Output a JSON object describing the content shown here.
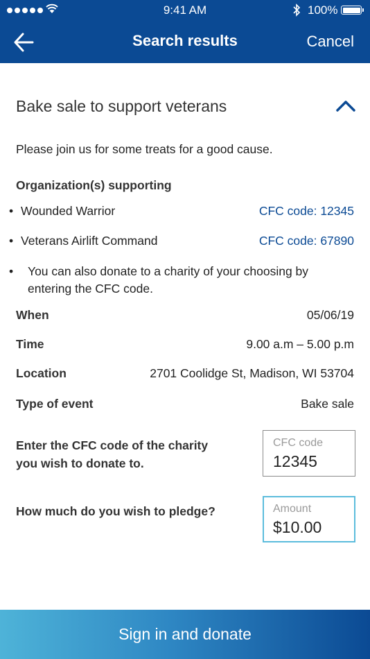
{
  "status_bar": {
    "time": "9:41 AM",
    "battery": "100%"
  },
  "nav": {
    "title": "Search results",
    "cancel_label": "Cancel",
    "back_icon": "arrow-left-icon"
  },
  "event": {
    "title": "Bake sale to support veterans",
    "collapse_icon": "chevron-up-icon",
    "description": "Please join us for some treats for a good cause.",
    "organizations_heading": "Organization(s) supporting",
    "organizations": [
      {
        "name": "Wounded Warrior",
        "cfc": "CFC code: 12345"
      },
      {
        "name": "Veterans Airlift Command",
        "cfc": "CFC code: 67890"
      }
    ],
    "note": "You can also donate to a charity of your choosing by entering the CFC code.",
    "details": [
      {
        "label": "When",
        "value": "05/06/19"
      },
      {
        "label": "Time",
        "value": "9.00 a.m – 5.00 p.m"
      },
      {
        "label": "Location",
        "value": "2701 Coolidge St, Madison, WI 53704"
      },
      {
        "label": "Type of event",
        "value": "Bake sale"
      }
    ]
  },
  "form": {
    "cfc_prompt": "Enter the CFC code of the charity you wish to donate to.",
    "cfc_field_label": "CFC code",
    "cfc_field_value": "12345",
    "amount_prompt": "How much do you wish to pledge?",
    "amount_field_label": "Amount",
    "amount_field_value": "$10.00"
  },
  "cta": {
    "label": "Sign in and donate"
  },
  "colors": {
    "header": "#0b4a94",
    "link": "#0b4a94",
    "active_border": "#5bbcdc",
    "cta_start": "#4eb3d8",
    "cta_end": "#0b4a94"
  }
}
